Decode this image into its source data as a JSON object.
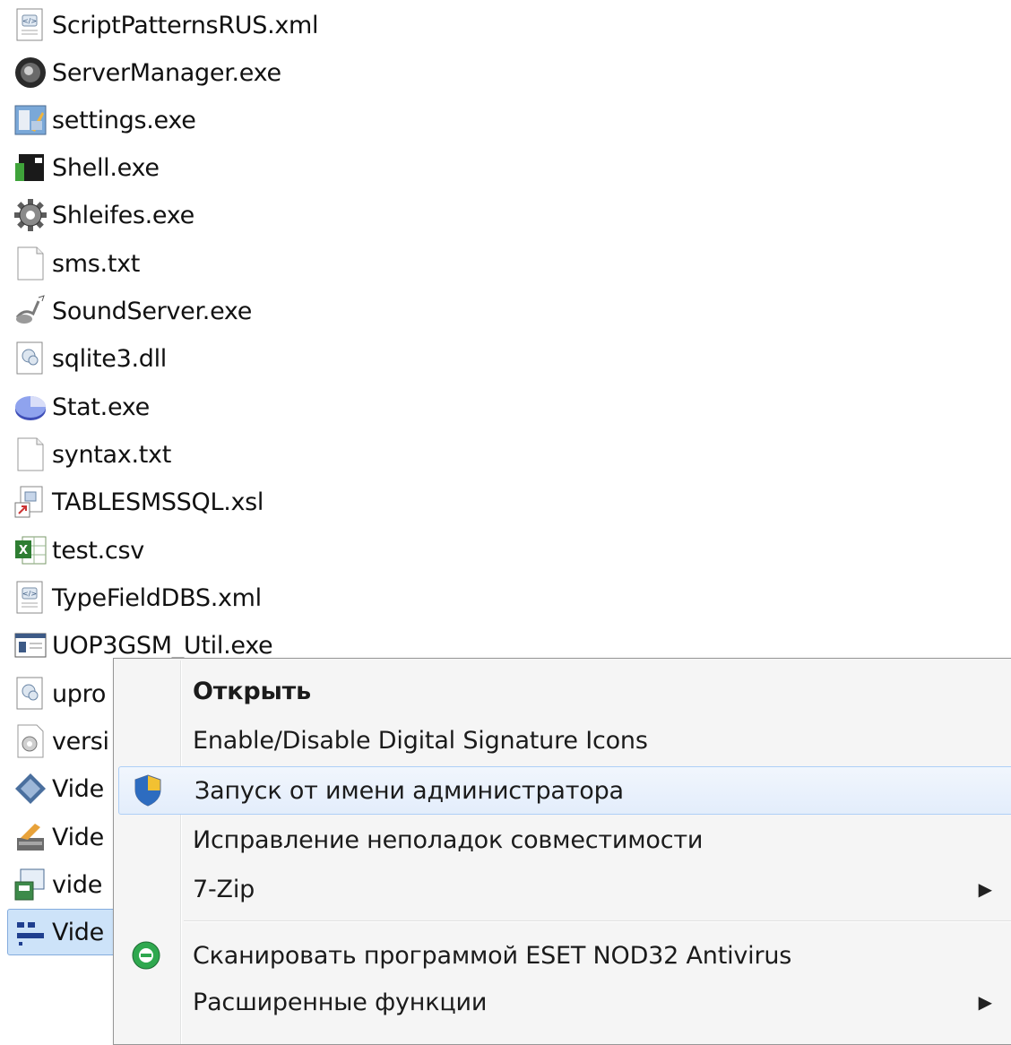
{
  "files": [
    {
      "name": "ScriptPatternsRUS.xml",
      "icon": "xml-file-icon"
    },
    {
      "name": "ServerManager.exe",
      "icon": "server-manager-icon"
    },
    {
      "name": "settings.exe",
      "icon": "settings-app-icon"
    },
    {
      "name": "Shell.exe",
      "icon": "shell-app-icon"
    },
    {
      "name": "Shleifes.exe",
      "icon": "gear-icon"
    },
    {
      "name": "sms.txt",
      "icon": "text-file-icon"
    },
    {
      "name": "SoundServer.exe",
      "icon": "sound-server-icon"
    },
    {
      "name": "sqlite3.dll",
      "icon": "dll-file-icon"
    },
    {
      "name": "Stat.exe",
      "icon": "pie-chart-icon"
    },
    {
      "name": "syntax.txt",
      "icon": "text-file-icon"
    },
    {
      "name": "TABLESMSSQL.xsl",
      "icon": "xsl-shortcut-icon"
    },
    {
      "name": "test.csv",
      "icon": "excel-csv-icon"
    },
    {
      "name": "TypeFieldDBS.xml",
      "icon": "xml-file-icon"
    },
    {
      "name": "UOP3GSM_Util.exe",
      "icon": "window-app-icon"
    },
    {
      "name": "upro",
      "icon": "dll-file-icon"
    },
    {
      "name": "versi",
      "icon": "config-file-icon"
    },
    {
      "name": "Vide",
      "icon": "diamond-app-icon"
    },
    {
      "name": "Vide",
      "icon": "video-tool-icon"
    },
    {
      "name": "vide",
      "icon": "video-setup-icon"
    },
    {
      "name": "Vide",
      "icon": "video-app-icon",
      "selected": true
    }
  ],
  "context_menu": {
    "items": [
      {
        "label": "Открыть",
        "bold": true,
        "icon": null
      },
      {
        "label": "Enable/Disable Digital Signature Icons",
        "icon": null
      },
      {
        "label": "Запуск от имени администратора",
        "icon": "uac-shield-icon",
        "hover": true
      },
      {
        "label": "Исправление неполадок совместимости",
        "icon": null
      },
      {
        "label": "7-Zip",
        "icon": null,
        "submenu": true
      },
      {
        "separator": true
      },
      {
        "label": "Сканировать программой ESET NOD32 Antivirus",
        "icon": "eset-nod32-icon"
      },
      {
        "label": "Расширенные функции",
        "icon": null,
        "submenu": true
      }
    ],
    "submenu_arrow": "▶"
  },
  "colors": {
    "selection_bg": "#cde3f9",
    "menu_bg": "#f5f5f5",
    "menu_hover_border": "#aecff7"
  }
}
